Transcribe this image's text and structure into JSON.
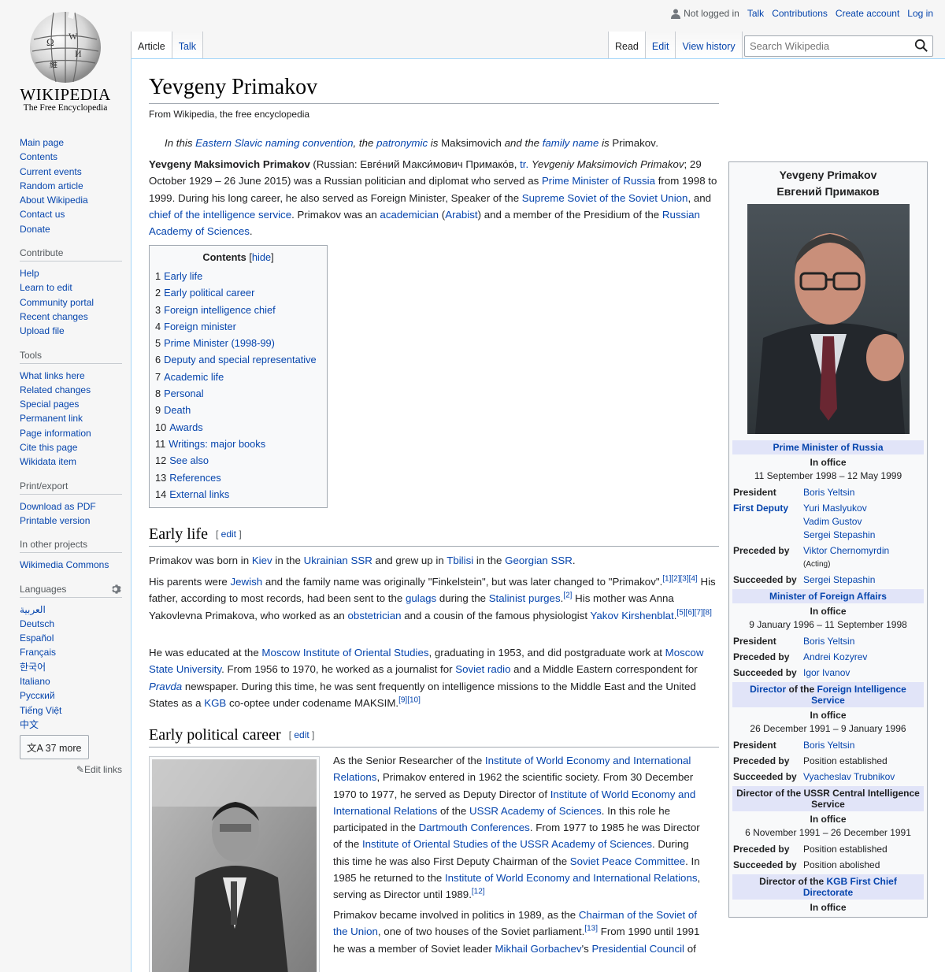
{
  "logo": {
    "wordmark": "WIKIPEDIA",
    "tagline": "The Free Encyclopedia"
  },
  "personal": {
    "not_logged_in": "Not logged in",
    "talk": "Talk",
    "contributions": "Contributions",
    "create_account": "Create account",
    "login": "Log in"
  },
  "tabs_left": {
    "article": "Article",
    "talk": "Talk"
  },
  "tabs_right": {
    "read": "Read",
    "edit": "Edit",
    "history": "View history"
  },
  "search": {
    "placeholder": "Search Wikipedia"
  },
  "sidebar": {
    "nav": [
      "Main page",
      "Contents",
      "Current events",
      "Random article",
      "About Wikipedia",
      "Contact us",
      "Donate"
    ],
    "contribute_title": "Contribute",
    "contribute": [
      "Help",
      "Learn to edit",
      "Community portal",
      "Recent changes",
      "Upload file"
    ],
    "tools_title": "Tools",
    "tools": [
      "What links here",
      "Related changes",
      "Special pages",
      "Permanent link",
      "Page information",
      "Cite this page",
      "Wikidata item"
    ],
    "print_title": "Print/export",
    "print": [
      "Download as PDF",
      "Printable version"
    ],
    "projects_title": "In other projects",
    "projects": [
      "Wikimedia Commons"
    ],
    "languages_title": "Languages",
    "languages": [
      "العربية",
      "Deutsch",
      "Español",
      "Français",
      "한국어",
      "Italiano",
      "Русский",
      "Tiếng Việt",
      "中文"
    ],
    "more_languages": "37 more",
    "edit_links": "Edit links"
  },
  "article": {
    "title": "Yevgeny Primakov",
    "tagline": "From Wikipedia, the free encyclopedia",
    "hatnote": {
      "t1": "In this ",
      "l1": "Eastern Slavic naming convention",
      "t2": ", the ",
      "l2": "patronymic",
      "t3": " is ",
      "v1": "Maksimovich",
      "t4": " and the ",
      "l3": "family name",
      "t5": " is ",
      "v2": "Primakov",
      "t6": "."
    },
    "lead": {
      "bold": "Yevgeny Maksimovich Primakov",
      "t1": " (Russian: Евге́ний Макси́мович Примако́в, ",
      "l_tr": "tr.",
      "t2": " ",
      "translit": "Yevgeniy Maksimovich Primakov",
      "t3": "; 29 October 1929 – 26 June 2015) was a Russian politician and diplomat who served as ",
      "l1": "Prime Minister of Russia",
      "t4": " from 1998 to 1999. During his long career, he also served as Foreign Minister, Speaker of the ",
      "l2": "Supreme Soviet of the Soviet Union",
      "t5": ", and ",
      "l3": "chief of the intelligence service",
      "t6": ". Primakov was an ",
      "l4": "academician",
      "t7": " (",
      "l5": "Arabist",
      "t8": ") and a member of the Presidium of the ",
      "l6": "Russian Academy of Sciences",
      "t9": "."
    },
    "toc": {
      "title": "Contents",
      "hide": "hide",
      "items": [
        {
          "num": "1",
          "label": "Early life"
        },
        {
          "num": "2",
          "label": "Early political career"
        },
        {
          "num": "3",
          "label": "Foreign intelligence chief"
        },
        {
          "num": "4",
          "label": "Foreign minister"
        },
        {
          "num": "5",
          "label": "Prime Minister (1998-99)"
        },
        {
          "num": "6",
          "label": "Deputy and special representative"
        },
        {
          "num": "7",
          "label": "Academic life"
        },
        {
          "num": "8",
          "label": "Personal"
        },
        {
          "num": "9",
          "label": "Death"
        },
        {
          "num": "10",
          "label": "Awards"
        },
        {
          "num": "11",
          "label": "Writings: major books"
        },
        {
          "num": "12",
          "label": "See also"
        },
        {
          "num": "13",
          "label": "References"
        },
        {
          "num": "14",
          "label": "External links"
        }
      ]
    },
    "edit_label": "edit",
    "early_life": {
      "heading": "Early life",
      "p1": {
        "t1": "Primakov was born in ",
        "l1": "Kiev",
        "t2": " in the ",
        "l2": "Ukrainian SSR",
        "t3": " and grew up in ",
        "l3": "Tbilisi",
        "t4": " in the ",
        "l4": "Georgian SSR",
        "t5": "."
      },
      "p2": {
        "t1": "His parents were ",
        "l1": "Jewish",
        "t2": " and the family name was originally \"Finkelstein\", but was later changed to \"Primakov\".",
        "r1": "[1][2][3][4]",
        "t3": " His father, according to most records, had been sent to the ",
        "l2": "gulags",
        "t4": " during the ",
        "l3": "Stalinist purges",
        "t5": ".",
        "r2": "[2]",
        "t6": " His mother was Anna Yakovlevna Primakova, who worked as an ",
        "l4": "obstetrician",
        "t7": " and a cousin of the famous physiologist ",
        "l5": "Yakov Kirshenblat",
        "t8": ".",
        "r3": "[5][6][7][8]"
      },
      "p3": {
        "t1": "He was educated at the ",
        "l1": "Moscow Institute of Oriental Studies",
        "t2": ", graduating in 1953, and did postgraduate work at ",
        "l2": "Moscow State University",
        "t3": ". From 1956 to 1970, he worked as a journalist for ",
        "l3": "Soviet radio",
        "t4": " and a Middle Eastern correspondent for ",
        "l4": "Pravda",
        "t5": " newspaper. During this time, he was sent frequently on intelligence missions to the Middle East and the United States as a ",
        "l5": "KGB",
        "t6": " co-optee under codename MAKSIM.",
        "r1": "[9][10]"
      }
    },
    "early_political": {
      "heading": "Early political career",
      "p1": {
        "t1": "As the Senior Researcher of the ",
        "l1": "Institute of World Economy and International Relations",
        "t2": ", Primakov entered in 1962 the scientific society. From 30 December 1970 to 1977, he served as Deputy Director of ",
        "l2": "Institute of World Economy and International Relations",
        "t3": " of the ",
        "l3": "USSR Academy of Sciences",
        "t4": ". In this role he participated in the ",
        "l4": "Dartmouth Conferences",
        "t5": ". From 1977 to 1985 he was Director of the ",
        "l5": "Institute of Oriental Studies of the USSR Academy of Sciences",
        "t6": ". During this time he was also First Deputy Chairman of the ",
        "l6": "Soviet Peace Committee",
        "t7": ". In 1985 he returned to the ",
        "l7": "Institute of World Economy and International Relations",
        "t8": ", serving as Director until 1989.",
        "r1": "[12]"
      },
      "p2": {
        "t1": "Primakov became involved in politics in 1989, as the ",
        "l1": "Chairman of the Soviet of the Union",
        "t2": ", one of two houses of the Soviet parliament.",
        "r1": "[13]",
        "t3": " From 1990 until 1991 he was a member of Soviet leader ",
        "l2": "Mikhail Gorbachev",
        "t4": "'s ",
        "l3": "Presidential Council",
        "t5": " of"
      }
    }
  },
  "infobox": {
    "name_en": "Yevgeny Primakov",
    "name_ru": "Евгений Примаков",
    "pm": {
      "title": "Prime Minister of Russia",
      "in_office": "In office",
      "dates": "11 September 1998 – 12 May 1999",
      "president_k": "President",
      "president_v": "Boris Yeltsin",
      "first_deputy_k": "First Deputy",
      "first_deputy_v": [
        "Yuri Maslyukov",
        "Vadim Gustov",
        "Sergei Stepashin"
      ],
      "preceded_k": "Preceded by",
      "preceded_v": "Viktor Chernomyrdin",
      "preceded_note": "(Acting)",
      "succeeded_k": "Succeeded by",
      "succeeded_v": "Sergei Stepashin"
    },
    "mfa": {
      "title": "Minister of Foreign Affairs",
      "in_office": "In office",
      "dates": "9 January 1996 – 11 September 1998",
      "president_k": "President",
      "president_v": "Boris Yeltsin",
      "preceded_k": "Preceded by",
      "preceded_v": "Andrei Kozyrev",
      "succeeded_k": "Succeeded by",
      "succeeded_v": "Igor Ivanov"
    },
    "svr": {
      "t1": "Director",
      "t2": " of the ",
      "t3": "Foreign Intelligence Service",
      "in_office": "In office",
      "dates": "26 December 1991 – 9 January 1996",
      "president_k": "President",
      "president_v": "Boris Yeltsin",
      "preceded_k": "Preceded by",
      "preceded_v": "Position established",
      "succeeded_k": "Succeeded by",
      "succeeded_v": "Vyacheslav Trubnikov"
    },
    "cis": {
      "title": "Director of the USSR Central Intelligence Service",
      "in_office": "In office",
      "dates": "6 November 1991 – 26 December 1991",
      "preceded_k": "Preceded by",
      "preceded_v": "Position established",
      "succeeded_k": "Succeeded by",
      "succeeded_v": "Position abolished"
    },
    "kgb": {
      "t1": "Director of the ",
      "t2": "KGB First Chief Directorate",
      "in_office": "In office"
    }
  }
}
